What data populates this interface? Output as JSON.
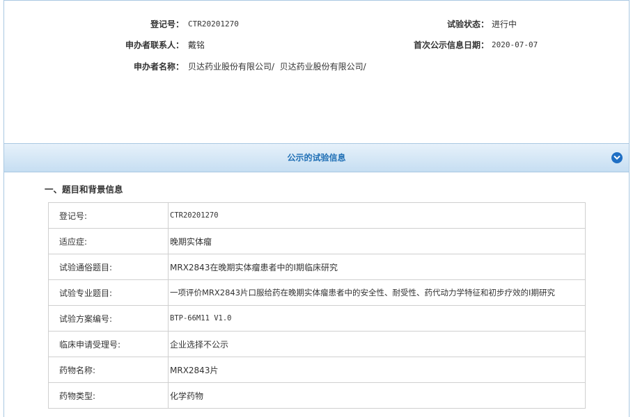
{
  "header": {
    "reg_no_label": "登记号：",
    "reg_no": "CTR20201270",
    "status_label": "试验状态：",
    "status": "进行中",
    "contact_label": "申办者联系人：",
    "contact": "戴铭",
    "first_pub_label": "首次公示信息日期：",
    "first_pub_date": "2020-07-07",
    "sponsor_label": "申办者名称：",
    "sponsor": "贝达药业股份有限公司/  贝达药业股份有限公司/"
  },
  "section": {
    "title": "公示的试验信息",
    "collapse_icon": "chevron-down-circle-icon",
    "accent": "#1f6fc4"
  },
  "subsection": {
    "heading": "一、题目和背景信息"
  },
  "table": {
    "rows": [
      {
        "label": "登记号:",
        "value": "CTR20201270"
      },
      {
        "label": "适应症:",
        "value": "晚期实体瘤"
      },
      {
        "label": "试验通俗题目:",
        "value": "MRX2843在晚期实体瘤患者中的I期临床研究"
      },
      {
        "label": "试验专业题目:",
        "value": "一项评价MRX2843片口服给药在晚期实体瘤患者中的安全性、耐受性、药代动力学特征和初步疗效的I期研究"
      },
      {
        "label": "试验方案编号:",
        "value": "BTP-66M11 V1.0"
      },
      {
        "label": "临床申请受理号:",
        "value": "企业选择不公示"
      },
      {
        "label": "药物名称:",
        "value": "MRX2843片"
      },
      {
        "label": "药物类型:",
        "value": "化学药物"
      }
    ]
  }
}
